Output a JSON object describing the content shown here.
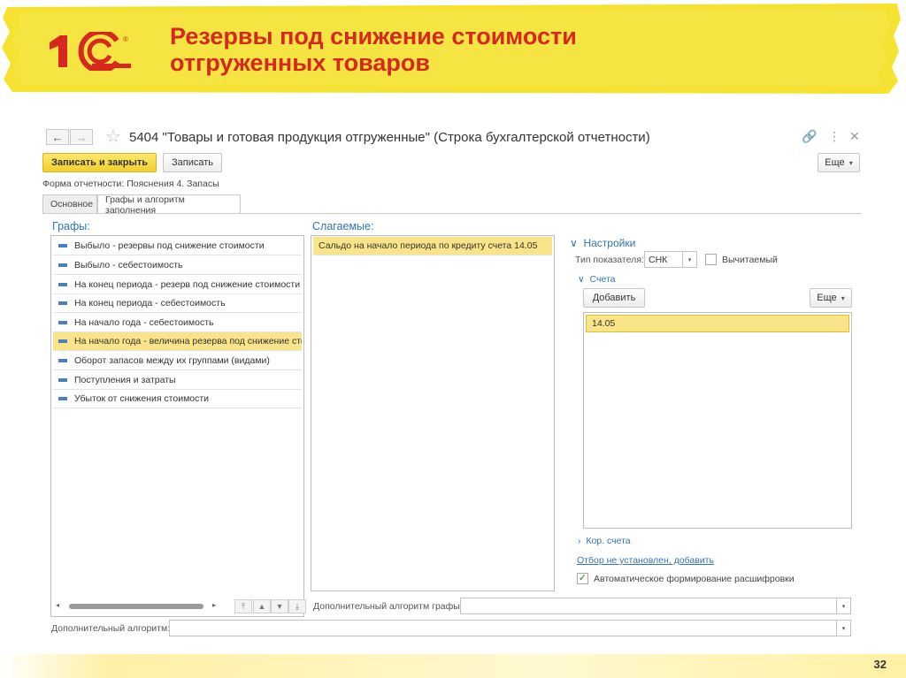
{
  "slide": {
    "title_line1": "Резервы под снижение стоимости",
    "title_line2": "отгруженных товаров",
    "logo_text": "1С",
    "page_number": "32",
    "accent_color": "#d6281e",
    "highlight_color": "#f5df1e"
  },
  "window": {
    "back_icon": "arrow-left-icon",
    "forward_icon": "arrow-right-icon",
    "favorite_icon": "star-icon",
    "title": "5404 \"Товары и готовая продукция отгруженные\" (Строка бухгалтерской отчетности)",
    "link_icon": "link-icon",
    "menu_icon": "more-vertical-icon",
    "close_icon": "close-icon"
  },
  "toolbar": {
    "save_close": "Записать и закрыть",
    "save": "Записать",
    "more": "Еще"
  },
  "form_label": "Форма отчетности: Пояснения 4. Запасы",
  "tabs": [
    "Основное",
    "Графы и алгоритм заполнения"
  ],
  "columns": {
    "header": "Графы:",
    "items": [
      {
        "label": "Выбыло - резервы под снижение стоимости",
        "selected": false
      },
      {
        "label": "Выбыло - себестоимость",
        "selected": false
      },
      {
        "label": "На конец периода -  резерв под снижение стоимости",
        "selected": false
      },
      {
        "label": "На конец периода -  себестоимость",
        "selected": false
      },
      {
        "label": "На начало года -  себестоимость",
        "selected": false
      },
      {
        "label": "На начало года - величина резерва под снижение сто...",
        "selected": true
      },
      {
        "label": "Оборот запасов между их группами (видами)",
        "selected": false
      },
      {
        "label": "Поступления и затраты",
        "selected": false
      },
      {
        "label": "Убыток от снижения стоимости",
        "selected": false
      }
    ]
  },
  "summands": {
    "header": "Слагаемые:",
    "items": [
      "Сальдо на начало периода по кредиту счета 14.05"
    ]
  },
  "settings": {
    "header": "Настройки",
    "indicator_type_label": "Тип показателя:",
    "indicator_type_value": "СНК",
    "subtractable_label": "Вычитаемый",
    "subtractable_checked": false,
    "accounts_header": "Счета",
    "add_button": "Добавить",
    "more_button": "Еще",
    "accounts": [
      "14.05"
    ],
    "corr_accounts": "Кор. счета",
    "filter_link": "Отбор не установлен, добавить",
    "auto_label": "Автоматическое формирование расшифровки",
    "auto_checked": true
  },
  "footer": {
    "extra_algo_column_label": "Дополнительный алгоритм графы:",
    "extra_algo_label": "Дополнительный алгоритм:"
  }
}
